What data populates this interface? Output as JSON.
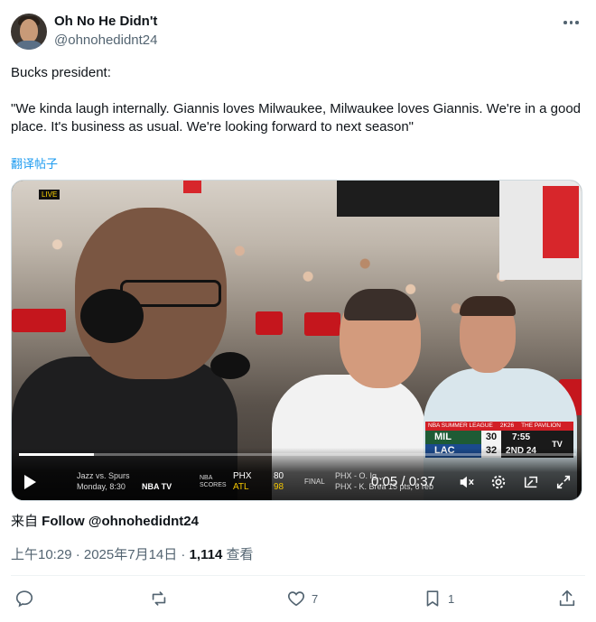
{
  "tweet": {
    "author_name": "Oh No He Didn't",
    "author_handle": "@ohnohedidnt24",
    "text_line1": "Bucks president:",
    "text_quote": "\"We kinda laugh internally. Giannis loves Milwaukee, Milwaukee loves Giannis. We're in a good place. It's business as usual. We're looking forward to next season\"",
    "translate_label": "翻译帖子"
  },
  "video": {
    "live_badge": "LIVE",
    "progress": 0.135,
    "time_display": "0:05 / 0:37",
    "scorebug": {
      "header": "NBA SUMMER LEAGUE",
      "header_brand": "2K26",
      "venue": "THE PAVILION",
      "team1": "MIL",
      "score1": "30",
      "clock": "7:55",
      "team2": "LAC",
      "score2": "32",
      "period": "2ND 24",
      "logo": "TV"
    },
    "ticker": {
      "game": "Jazz vs. Spurs",
      "game_time": "Monday, 8:30",
      "nbatv": "NBA TV",
      "scores_label": "NBA SCORES",
      "team_a": "PHX",
      "team_b": "ATL",
      "score_a": "80",
      "score_b": "98",
      "final": "FINAL",
      "note_a": "PHX - O. Ig...",
      "note_b": "PHX - K. Brea 15 pts, 6 reb"
    }
  },
  "footer": {
    "source_prefix": "来自 ",
    "source_link": "Follow @ohnohedidnt24",
    "time": "上午10:29 · 2025年7月14日 · ",
    "views_count": "1,114",
    "views_label": " 查看"
  },
  "actions": {
    "reply_count": "",
    "retweet_count": "",
    "like_count": "7",
    "bookmark_count": "1"
  },
  "colors": {
    "accent": "#1d9bf0",
    "text_secondary": "#536471",
    "scorebug_red": "#d21f26"
  }
}
